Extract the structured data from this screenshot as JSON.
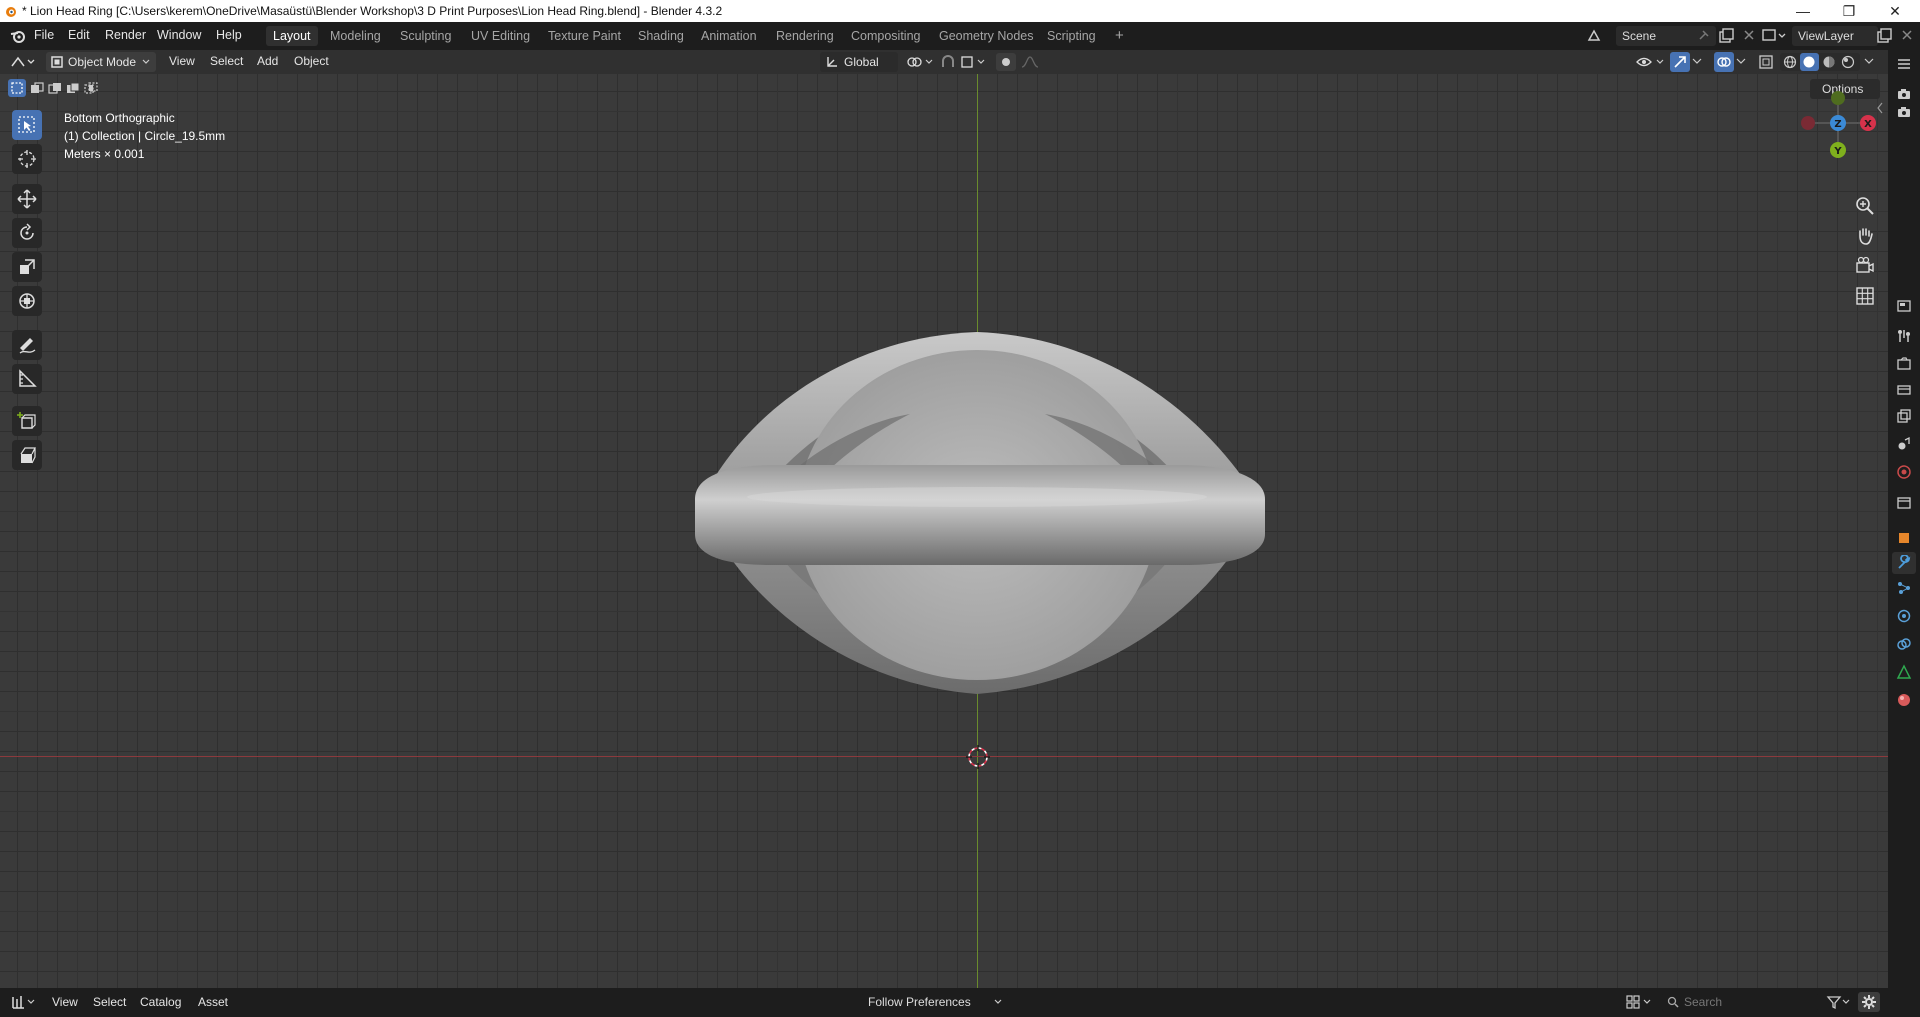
{
  "window": {
    "title": "* Lion Head Ring [C:\\Users\\kerem\\OneDrive\\Masaüstü\\Blender Workshop\\3 D Print Purposes\\Lion Head Ring.blend] - Blender 4.3.2",
    "minimize": "—",
    "restore": "❐",
    "close": "✕"
  },
  "menubar": {
    "items": [
      "File",
      "Edit",
      "Render",
      "Window",
      "Help"
    ]
  },
  "workspaces": {
    "tabs": [
      "Layout",
      "Modeling",
      "Sculpting",
      "UV Editing",
      "Texture Paint",
      "Shading",
      "Animation",
      "Rendering",
      "Compositing",
      "Geometry Nodes",
      "Scripting"
    ],
    "active": "Layout",
    "add": "+"
  },
  "scene": {
    "scene_name": "Scene",
    "view_layer": "ViewLayer"
  },
  "header": {
    "mode": "Object Mode",
    "menus": [
      "View",
      "Select",
      "Add",
      "Object"
    ],
    "orientation": "Global",
    "options": "Options"
  },
  "viewport": {
    "view_name": "Bottom Orthographic",
    "collection": "(1) Collection | Circle_19.5mm",
    "units": "Meters × 0.001",
    "gizmo": {
      "x": "X",
      "y": "Y",
      "z": "Z"
    }
  },
  "bottombar": {
    "menus": [
      "View",
      "Select",
      "Catalog",
      "Asset"
    ],
    "follow": "Follow Preferences",
    "search_placeholder": "Search"
  },
  "colors": {
    "accent": "#4772b3",
    "x_axis": "#d6324b",
    "y_axis": "#7fb01d",
    "z_axis": "#3b8ad6"
  }
}
